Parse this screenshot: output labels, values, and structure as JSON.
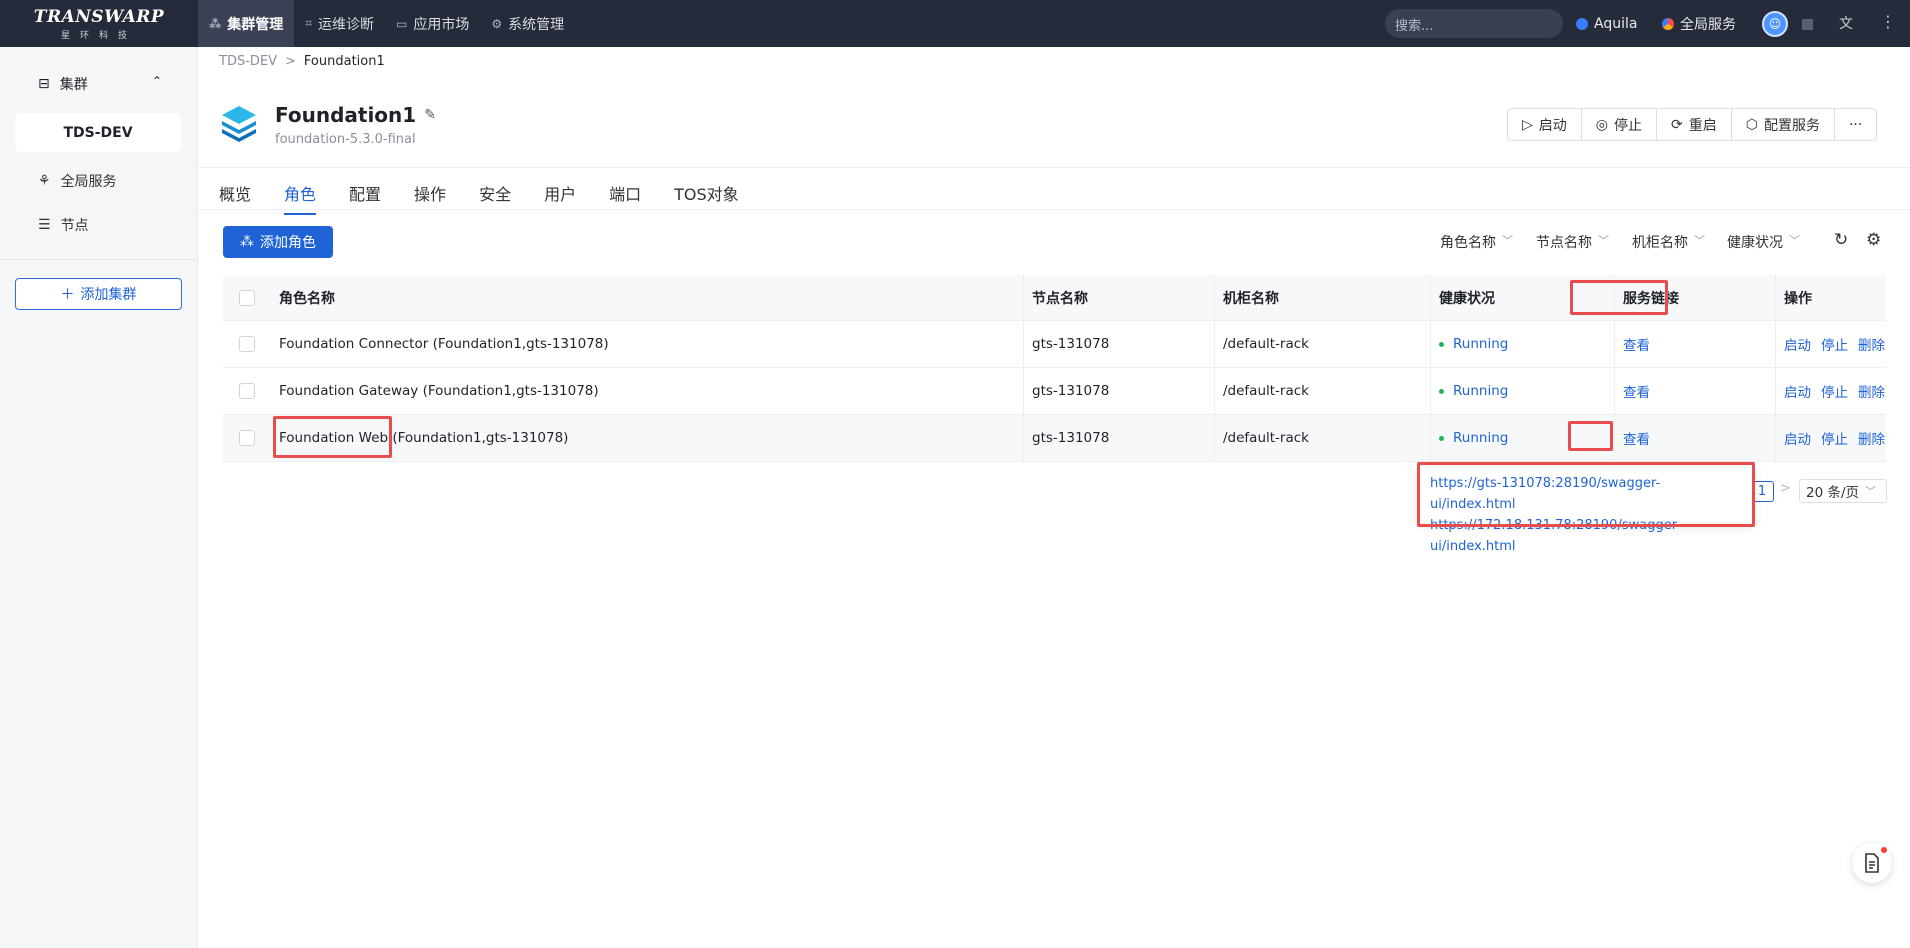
{
  "logo": {
    "brand": "TRANSWARP",
    "sub": "星环科技"
  },
  "topnav": [
    {
      "label": "集群管理",
      "icon": "cluster-icon",
      "active": true
    },
    {
      "label": "运维诊断",
      "icon": "diagnose-icon",
      "active": false
    },
    {
      "label": "应用市场",
      "icon": "market-icon",
      "active": false
    },
    {
      "label": "系统管理",
      "icon": "gear-icon",
      "active": false
    }
  ],
  "search": {
    "placeholder": "搜索..."
  },
  "topright": {
    "aquila": "Aquila",
    "global_services": "全局服务"
  },
  "sidebar": {
    "header": "集群",
    "cluster": "TDS-DEV",
    "items": [
      {
        "label": "全局服务"
      },
      {
        "label": "节点"
      }
    ],
    "add_button": "添加集群"
  },
  "breadcrumb": {
    "parent": "TDS-DEV",
    "sep": ">",
    "current": "Foundation1"
  },
  "service": {
    "name": "Foundation1",
    "version": "foundation-5.3.0-final"
  },
  "actions": {
    "start": "启动",
    "stop": "停止",
    "restart": "重启",
    "config": "配置服务",
    "more": "···"
  },
  "tabs": [
    "概览",
    "角色",
    "配置",
    "操作",
    "安全",
    "用户",
    "端口",
    "TOS对象"
  ],
  "active_tab": "角色",
  "toolbar": {
    "add_role": "添加角色",
    "filters": [
      "角色名称",
      "节点名称",
      "机柜名称",
      "健康状况"
    ]
  },
  "table": {
    "columns": [
      "角色名称",
      "节点名称",
      "机柜名称",
      "健康状况",
      "服务链接",
      "操作"
    ],
    "rows": [
      {
        "role": "Foundation Connector (Foundation1,gts-131078)",
        "node": "gts-131078",
        "rack": "/default-rack",
        "status": "Running",
        "link": "查看",
        "ops": [
          "启动",
          "停止",
          "删除"
        ]
      },
      {
        "role": "Foundation Gateway (Foundation1,gts-131078)",
        "node": "gts-131078",
        "rack": "/default-rack",
        "status": "Running",
        "link": "查看",
        "ops": [
          "启动",
          "停止",
          "删除"
        ]
      },
      {
        "role": "Foundation Web (Foundation1,gts-131078)",
        "node": "gts-131078",
        "rack": "/default-rack",
        "status": "Running",
        "link": "查看",
        "ops": [
          "启动",
          "停止",
          "删除"
        ]
      }
    ]
  },
  "popover": {
    "links": [
      "https://gts-131078:28190/swagger-ui/index.html",
      "https://172.18.131.78:28190/swagger-ui/index.html"
    ]
  },
  "pagination": {
    "current": "1",
    "page_size": "20 条/页"
  },
  "colors": {
    "primary": "#1f63d6",
    "topbar": "#252b3a",
    "highlight": "#e84c4c",
    "status_ok": "#22b35e"
  }
}
